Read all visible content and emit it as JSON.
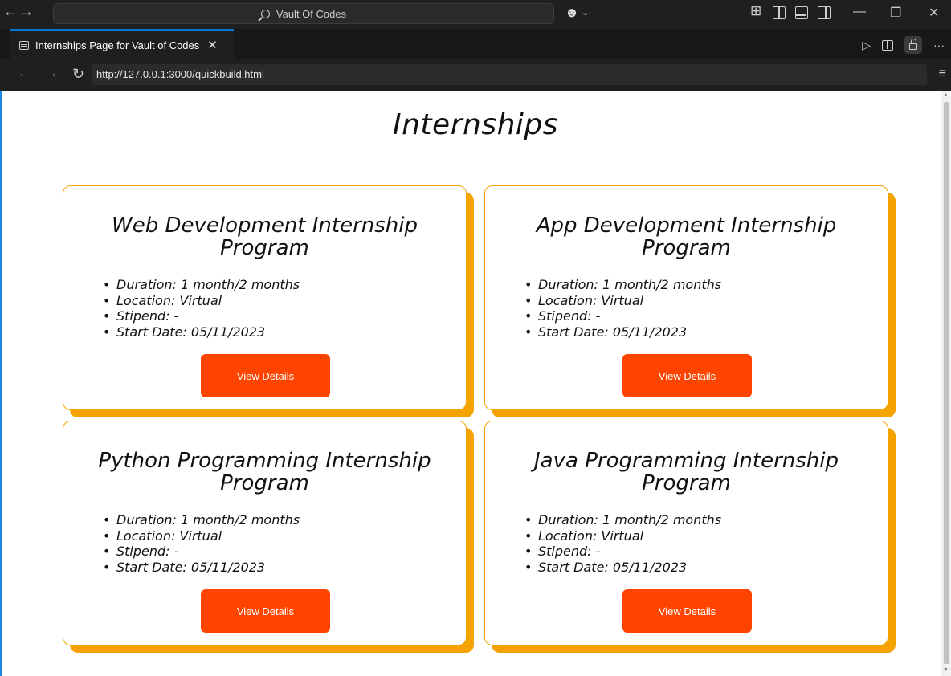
{
  "titlebar": {
    "back_icon": "arrow-left-icon",
    "forward_icon": "arrow-right-icon",
    "search_text": "Vault Of Codes",
    "copilot_icon": "copilot-icon",
    "window_controls": [
      "minimize",
      "restore",
      "close"
    ]
  },
  "tab": {
    "label": "Internships Page for Vault of Codes",
    "close_glyph": "✕"
  },
  "address": {
    "url": "http://127.0.0.1:3000/quickbuild.html"
  },
  "page": {
    "title": "Internships",
    "accent_color": "#f5a300",
    "button_color": "#ff4400",
    "cards": [
      {
        "title": "Web Development Internship Program",
        "items": [
          "Duration: 1 month/2 months",
          "Location: Virtual",
          "Stipend: -",
          "Start Date: 05/11/2023"
        ],
        "button": "View Details"
      },
      {
        "title": "App Development Internship Program",
        "items": [
          "Duration: 1 month/2 months",
          "Location: Virtual",
          "Stipend: -",
          "Start Date: 05/11/2023"
        ],
        "button": "View Details"
      },
      {
        "title": "Python Programming Internship Program",
        "items": [
          "Duration: 1 month/2 months",
          "Location: Virtual",
          "Stipend: -",
          "Start Date: 05/11/2023"
        ],
        "button": "View Details"
      },
      {
        "title": "Java Programming Internship Program",
        "items": [
          "Duration: 1 month/2 months",
          "Location: Virtual",
          "Stipend: -",
          "Start Date: 05/11/2023"
        ],
        "button": "View Details"
      }
    ]
  }
}
